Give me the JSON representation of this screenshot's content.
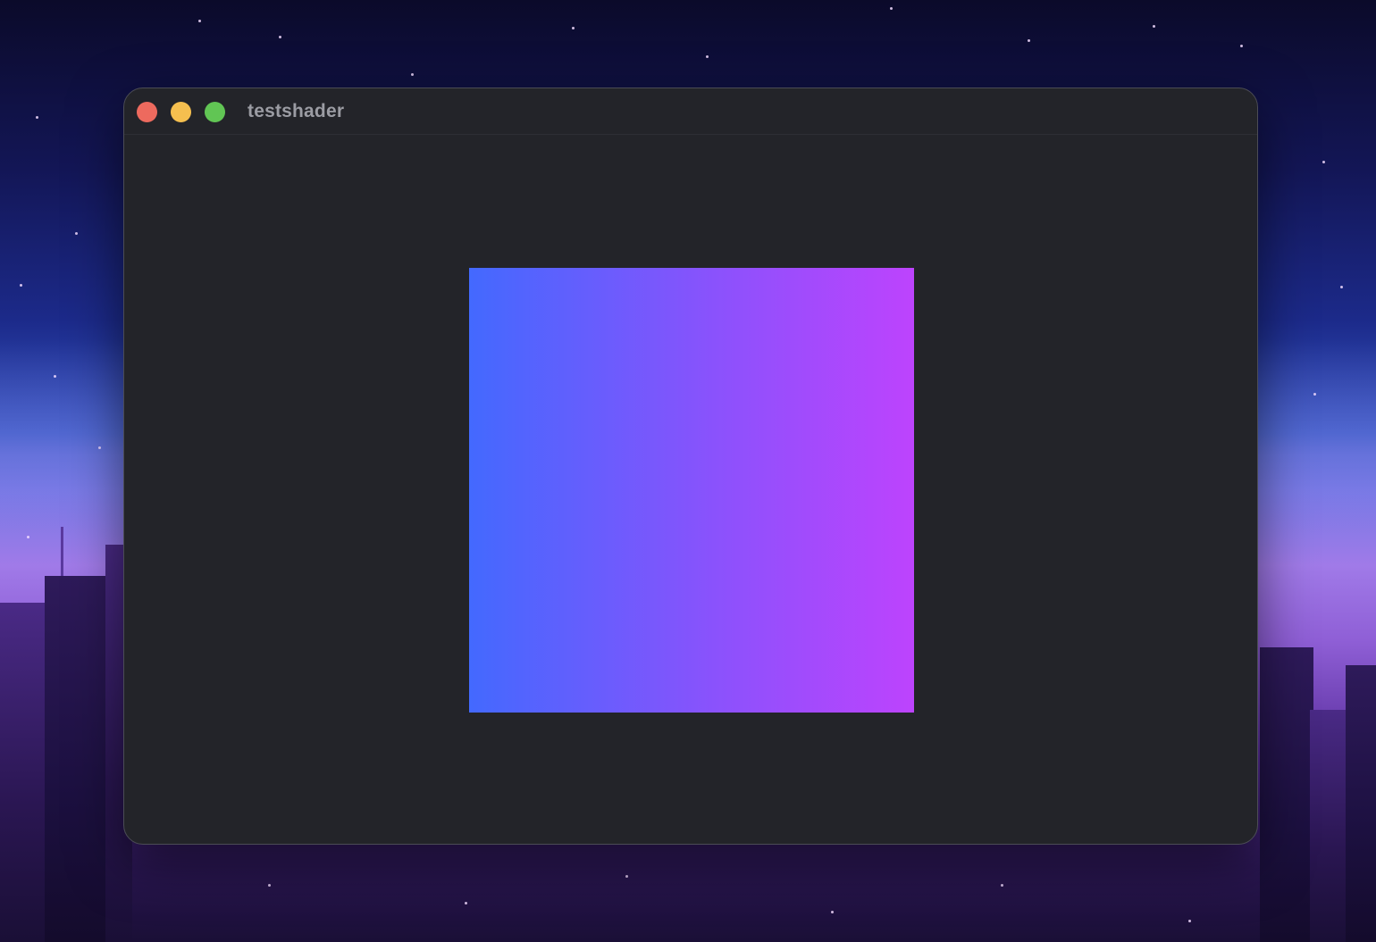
{
  "window": {
    "title": "testshader",
    "buttons": {
      "close": "close",
      "minimize": "minimize",
      "zoom": "zoom"
    }
  },
  "canvas": {
    "gradient_start_color": "#4369fe",
    "gradient_mid_color": "#8a52fc",
    "gradient_end_color": "#bd43fd"
  },
  "colors": {
    "window_background": "#232429",
    "title_text": "#9b9ca3",
    "close_button": "#ed6a5e",
    "minimize_button": "#f5bf4f",
    "zoom_button": "#61c554"
  }
}
